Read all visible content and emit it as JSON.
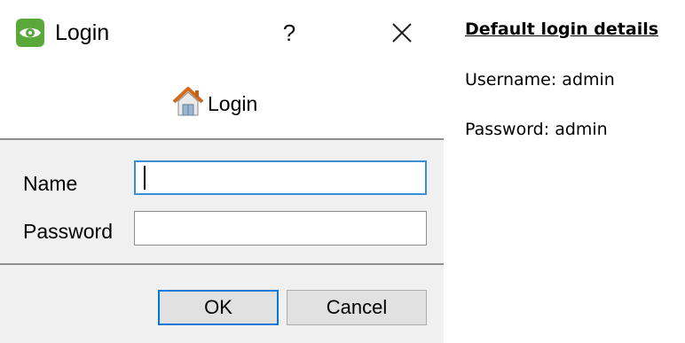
{
  "dialog": {
    "title": "Login",
    "help_label": "?",
    "header_title": "Login",
    "fields": {
      "name_label": "Name",
      "name_value": "",
      "password_label": "Password",
      "password_value": ""
    },
    "buttons": {
      "ok_label": "OK",
      "cancel_label": "Cancel"
    },
    "icons": {
      "app": "eye-icon",
      "help": "question-icon",
      "close": "close-icon",
      "header": "house-icon"
    }
  },
  "notes": {
    "heading": "Default login details",
    "username_line": "Username: admin",
    "password_line": "Password: admin"
  },
  "colors": {
    "app_icon_green": "#5aa83a",
    "focus_blue": "#3c8ed6",
    "default_button_blue": "#0078d7",
    "dialog_bg": "#f0f0f0"
  }
}
